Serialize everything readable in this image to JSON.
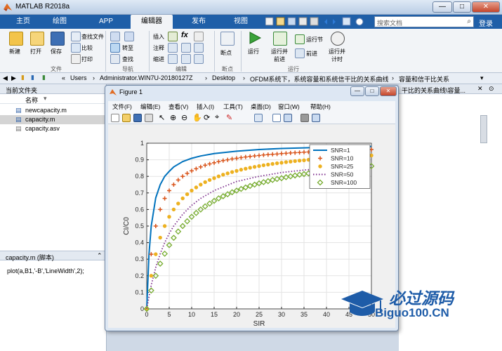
{
  "window": {
    "title": "MATLAB R2018a"
  },
  "tabs": [
    "主页",
    "绘图",
    "APP",
    "编辑器",
    "发布",
    "视图"
  ],
  "search": {
    "placeholder": "搜索文档"
  },
  "login_label": "登录",
  "ribbon": {
    "file_group": {
      "label": "文件",
      "new": "新建",
      "open": "打开",
      "save": "保存",
      "find_files": "查找文件",
      "compare": "比较",
      "print": "打印"
    },
    "nav_group": {
      "label": "导航",
      "goto": "转至",
      "find": "查找"
    },
    "edit_group": {
      "label": "编辑",
      "insert": "插入",
      "comment": "注释",
      "indent": "缩进"
    },
    "breakpoint_group": {
      "label": "断点",
      "breakpoints": "断点"
    },
    "run_group": {
      "label": "运行",
      "run": "运行",
      "run_advance": "运行并\n前进",
      "run_section": "运行节",
      "advance": "前进",
      "run_time": "运行并\n计时"
    }
  },
  "address": {
    "path": [
      "Users",
      "Administrator.WIN7U-20180127Z",
      "Desktop",
      "OFDM系统下，系统容量和系统信干比的关系曲线",
      "容量和信干比关系"
    ]
  },
  "current_folder": {
    "title": "当前文件夹",
    "column": "名称",
    "files": [
      "newcapacity.m",
      "capacity.m",
      "capacity.asv"
    ],
    "selected": "capacity.m"
  },
  "details": {
    "title": "capacity.m  (脚本)",
    "code": "plot(a,B1,'-B','LineWidth',2);"
  },
  "right_pane": {
    "crumb": "干比的关系曲线\\容量..."
  },
  "figure": {
    "title": "Figure 1",
    "menus": [
      "文件(F)",
      "编辑(E)",
      "查看(V)",
      "插入(I)",
      "工具(T)",
      "桌面(D)",
      "窗口(W)",
      "帮助(H)"
    ]
  },
  "chart_data": {
    "type": "line",
    "xlabel": "SIR",
    "ylabel": "CI/C0",
    "xlim": [
      0,
      50
    ],
    "ylim": [
      0,
      1
    ],
    "xticks": [
      0,
      5,
      10,
      15,
      20,
      25,
      30,
      35,
      40,
      45,
      50
    ],
    "yticks": [
      0,
      0.1,
      0.2,
      0.3,
      0.4,
      0.5,
      0.6,
      0.7,
      0.8,
      0.9,
      1
    ],
    "grid": true,
    "legend_position": "top-right",
    "series": [
      {
        "name": "SNR=1",
        "style": "solid",
        "color": "#0072bd",
        "x": [
          0,
          0.5,
          1,
          2,
          3,
          4,
          5,
          6,
          8,
          10,
          12,
          15,
          20,
          25,
          30,
          35,
          40,
          45,
          50
        ],
        "y": [
          0,
          0.33,
          0.5,
          0.67,
          0.75,
          0.8,
          0.83,
          0.857,
          0.889,
          0.909,
          0.923,
          0.9375,
          0.952,
          0.962,
          0.968,
          0.972,
          0.976,
          0.978,
          0.98
        ]
      },
      {
        "name": "SNR=10",
        "style": "plus",
        "color": "#d95319",
        "x": [
          0,
          1,
          2,
          3,
          4,
          5,
          6,
          7,
          8,
          9,
          10,
          11,
          12,
          13,
          14,
          15,
          16,
          17,
          18,
          19,
          20,
          21,
          22,
          23,
          24,
          25,
          26,
          27,
          28,
          29,
          30,
          31,
          32,
          33,
          34,
          35,
          36,
          37,
          38,
          39,
          40,
          41,
          42,
          43,
          44,
          45,
          46,
          47,
          48,
          49,
          50
        ],
        "y": [
          0,
          0.33,
          0.5,
          0.6,
          0.667,
          0.714,
          0.75,
          0.778,
          0.8,
          0.818,
          0.833,
          0.846,
          0.857,
          0.867,
          0.875,
          0.882,
          0.889,
          0.895,
          0.9,
          0.905,
          0.909,
          0.913,
          0.917,
          0.92,
          0.923,
          0.926,
          0.929,
          0.931,
          0.933,
          0.935,
          0.9375,
          0.939,
          0.941,
          0.943,
          0.944,
          0.946,
          0.947,
          0.949,
          0.95,
          0.951,
          0.952,
          0.953,
          0.955,
          0.956,
          0.957,
          0.957,
          0.958,
          0.959,
          0.96,
          0.961,
          0.962
        ]
      },
      {
        "name": "SNR=25",
        "style": "dot",
        "color": "#edb120",
        "x": [
          0,
          1,
          2,
          3,
          4,
          5,
          6,
          7,
          8,
          9,
          10,
          11,
          12,
          13,
          14,
          15,
          16,
          17,
          18,
          19,
          20,
          21,
          22,
          23,
          24,
          25,
          26,
          27,
          28,
          29,
          30,
          31,
          32,
          33,
          34,
          35,
          36,
          37,
          38,
          39,
          40,
          41,
          42,
          43,
          44,
          45,
          46,
          47,
          48,
          49,
          50
        ],
        "y": [
          0,
          0.2,
          0.33,
          0.43,
          0.5,
          0.556,
          0.6,
          0.636,
          0.667,
          0.692,
          0.714,
          0.733,
          0.75,
          0.765,
          0.778,
          0.789,
          0.8,
          0.81,
          0.818,
          0.826,
          0.833,
          0.84,
          0.846,
          0.852,
          0.857,
          0.862,
          0.867,
          0.871,
          0.875,
          0.879,
          0.882,
          0.886,
          0.889,
          0.892,
          0.895,
          0.897,
          0.9,
          0.902,
          0.905,
          0.907,
          0.909,
          0.911,
          0.913,
          0.915,
          0.917,
          0.918,
          0.92,
          0.922,
          0.923,
          0.925,
          0.926
        ]
      },
      {
        "name": "SNR=50",
        "style": "dotted",
        "color": "#7e2f8e",
        "x": [
          0,
          1,
          2,
          3,
          4,
          5,
          6,
          8,
          10,
          12,
          15,
          20,
          25,
          30,
          35,
          40,
          45,
          50
        ],
        "y": [
          0,
          0.143,
          0.25,
          0.333,
          0.4,
          0.455,
          0.5,
          0.571,
          0.625,
          0.667,
          0.714,
          0.769,
          0.8,
          0.823,
          0.838,
          0.85,
          0.86,
          0.87
        ]
      },
      {
        "name": "SNR=100",
        "style": "diamond",
        "color": "#77ac30",
        "x": [
          0,
          1,
          2,
          3,
          4,
          5,
          6,
          7,
          8,
          9,
          10,
          11,
          12,
          13,
          14,
          15,
          16,
          17,
          18,
          19,
          20,
          21,
          22,
          23,
          24,
          25,
          26,
          27,
          28,
          29,
          30,
          31,
          32,
          33,
          34,
          35,
          36,
          37,
          38,
          39,
          40,
          41,
          42,
          43,
          44,
          45,
          46,
          47,
          48,
          49,
          50
        ],
        "y": [
          0,
          0.111,
          0.2,
          0.273,
          0.333,
          0.385,
          0.429,
          0.467,
          0.5,
          0.529,
          0.556,
          0.579,
          0.6,
          0.619,
          0.636,
          0.652,
          0.667,
          0.68,
          0.692,
          0.704,
          0.714,
          0.724,
          0.733,
          0.742,
          0.75,
          0.758,
          0.765,
          0.771,
          0.778,
          0.784,
          0.789,
          0.795,
          0.8,
          0.805,
          0.81,
          0.814,
          0.818,
          0.822,
          0.826,
          0.83,
          0.833,
          0.837,
          0.84,
          0.843,
          0.846,
          0.849,
          0.852,
          0.855,
          0.857,
          0.86,
          0.862
        ]
      }
    ]
  },
  "watermark": {
    "brand": "必过源码",
    "site": "Biguo100.CN"
  }
}
